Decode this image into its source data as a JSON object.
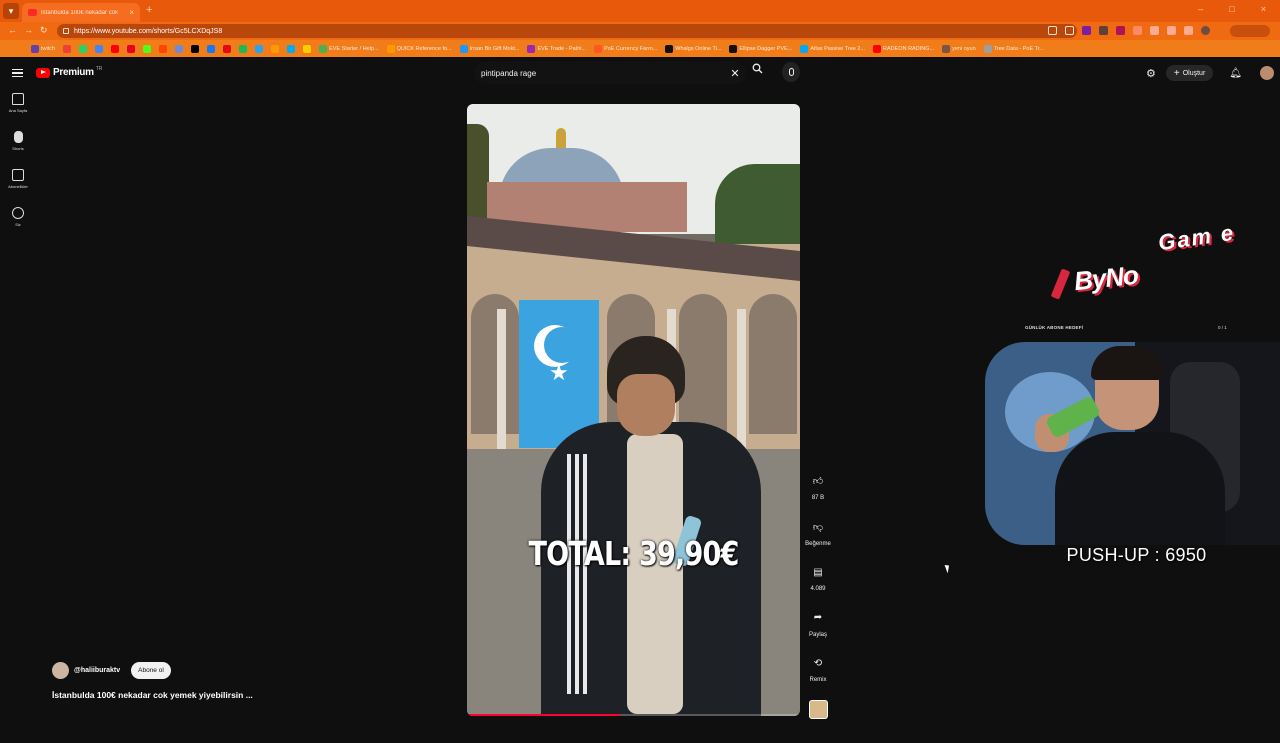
{
  "browser": {
    "tab_title": "İstanbulda 100€ nekadar cok",
    "url": "https://www.youtube.com/shorts/Gc5LCXDqJS8",
    "bookmarks": [
      {
        "label": "twitch",
        "color": "#6441a5"
      },
      {
        "label": "",
        "color": "#ea4335"
      },
      {
        "label": "",
        "color": "#25d366"
      },
      {
        "label": "",
        "color": "#4285f4"
      },
      {
        "label": "",
        "color": "#ff0000"
      },
      {
        "label": "",
        "color": "#e60023"
      },
      {
        "label": "",
        "color": "#53fc18"
      },
      {
        "label": "",
        "color": "#ff4500"
      },
      {
        "label": "",
        "color": "#7289da"
      },
      {
        "label": "",
        "color": "#000000"
      },
      {
        "label": "",
        "color": "#1877f2"
      },
      {
        "label": "",
        "color": "#e50914"
      },
      {
        "label": "",
        "color": "#1db954"
      },
      {
        "label": "",
        "color": "#2aa3ef"
      },
      {
        "label": "",
        "color": "#ff9900"
      },
      {
        "label": "",
        "color": "#00aced"
      },
      {
        "label": "",
        "color": "#ffcc00"
      },
      {
        "label": "EVE Starter / Help...",
        "color": "#4caf50"
      },
      {
        "label": "QUICK Reference fo...",
        "color": "#ff9800"
      },
      {
        "label": "Insan Bir Gift Mokt...",
        "color": "#2196f3"
      },
      {
        "label": "EVE Trade - Pathi...",
        "color": "#9c27b0"
      },
      {
        "label": "PoE Currency Farm...",
        "color": "#ff5722"
      },
      {
        "label": "Whalgs Online Ti...",
        "color": "#111111"
      },
      {
        "label": "Ellipse Dagger PVE...",
        "color": "#111111"
      },
      {
        "label": "Atlas Passive Tree 2...",
        "color": "#03a9f4"
      },
      {
        "label": "RADEON RADING...",
        "color": "#ff0000"
      },
      {
        "label": "yeni oyun",
        "color": "#795548"
      },
      {
        "label": "Tree Data - PoE Tr...",
        "color": "#9e9e9e"
      }
    ]
  },
  "header": {
    "logo_text": "Premium",
    "logo_region": "TR",
    "search_value": "pintipanda rage",
    "create_label": "Oluştur"
  },
  "rail": {
    "items": [
      {
        "label": "Ana Sayfa",
        "icon": "home-icon"
      },
      {
        "label": "Shorts",
        "icon": "shorts-icon"
      },
      {
        "label": "Abonelikler",
        "icon": "subscriptions-icon"
      },
      {
        "label": "Siz",
        "icon": "you-icon"
      }
    ]
  },
  "short": {
    "overlay_text": "TOTAL: 39,90€",
    "channel": "@haliiburaktv",
    "subscribe_label": "Abone ol",
    "title": "İstanbulda 100€ nekadar cok yemek yiyebilirsin ...",
    "progress": 0.46,
    "actions": {
      "like_count": "87 B",
      "dislike_label": "Beğenme",
      "comment_count": "4.089",
      "share_label": "Paylaş",
      "remix_label": "Remix"
    }
  },
  "overlay": {
    "brand_byno": "ByNo",
    "brand_game": "Gam e",
    "goal_label": "GÜNLÜK ABONE HEDEFİ",
    "goal_value": "0 / 1",
    "pushup": "PUSH-UP : 6950"
  },
  "colors": {
    "browser_accent": "#e8590c",
    "yt_background": "#0f0f0f",
    "yt_red": "#ff0000"
  }
}
